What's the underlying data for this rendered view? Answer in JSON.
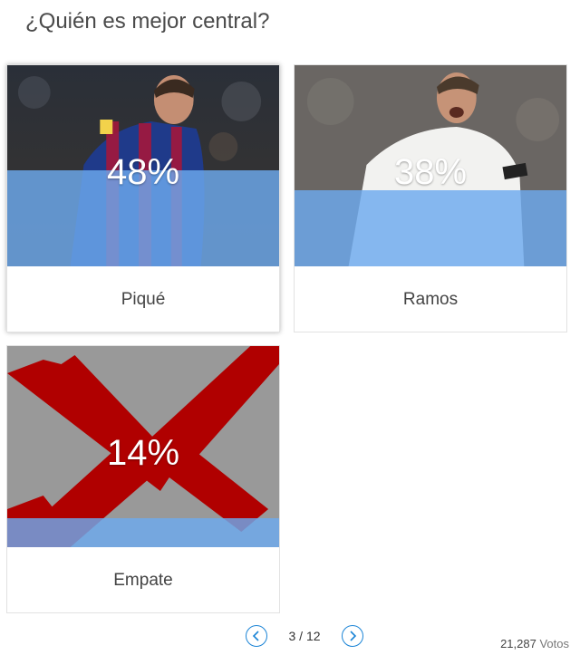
{
  "poll": {
    "question": "¿Quién es mejor central?",
    "options": [
      {
        "label": "Piqué",
        "percent": 48,
        "percent_text": "48%",
        "image": "player-photo-pique",
        "selected": true
      },
      {
        "label": "Ramos",
        "percent": 38,
        "percent_text": "38%",
        "image": "player-photo-ramos",
        "selected": false
      },
      {
        "label": "Empate",
        "percent": 14,
        "percent_text": "14%",
        "image": "red-x-draw-image",
        "selected": false
      }
    ]
  },
  "pager": {
    "indicator": "3 / 12",
    "prev_icon": "chevron-left-icon",
    "next_icon": "chevron-right-icon"
  },
  "votes": {
    "count": "21,287",
    "label": "Votos"
  },
  "colors": {
    "fill": "#6caaee",
    "nav_accent": "#1a84d6",
    "barca_blue": "#1f3a8a",
    "barca_red": "#a3173b",
    "x_red": "#b00000"
  }
}
